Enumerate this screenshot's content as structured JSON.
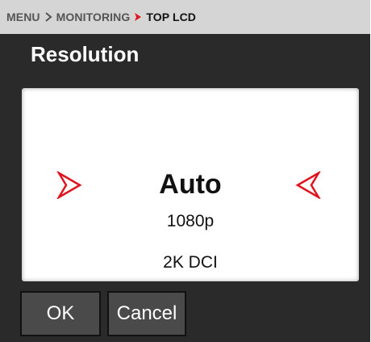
{
  "breadcrumb": {
    "items": [
      "MENU",
      "MONITORING",
      "TOP LCD"
    ]
  },
  "title": "Resolution",
  "picker": {
    "selected": "Auto",
    "options": [
      "1080p",
      "2K DCI"
    ]
  },
  "buttons": {
    "ok_label": "OK",
    "cancel_label": "Cancel"
  },
  "colors": {
    "accent": "#e0141e",
    "background": "#2a2a2a",
    "header": "#d5d5d5"
  },
  "icons": {
    "separator": "chevron-right-icon",
    "active_separator": "caret-right-icon",
    "left_arrow": "arrow-right-outline-icon",
    "right_arrow": "arrow-left-outline-icon"
  }
}
